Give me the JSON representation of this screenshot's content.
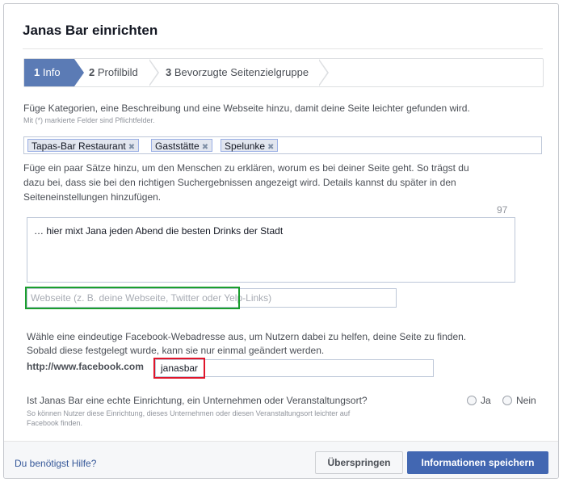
{
  "dialog": {
    "title": "Janas Bar einrichten"
  },
  "steps": [
    {
      "num": "1",
      "label": "Info"
    },
    {
      "num": "2",
      "label": "Profilbild"
    },
    {
      "num": "3",
      "label": "Bevorzugte Seitenzielgruppe"
    }
  ],
  "categories": {
    "intro": "Füge Kategorien, eine Beschreibung und eine Webseite hinzu, damit deine Seite leichter gefunden wird.",
    "required_note": "Mit (*) markierte Felder sind Pflichtfelder.",
    "tokens": [
      "Tapas-Bar Restaurant",
      "Gaststätte",
      "Spelunke"
    ],
    "remove_glyph": "✖"
  },
  "description": {
    "help_line1": "Füge ein paar Sätze hinzu, um den Menschen zu erklären, worum es bei deiner Seite geht. So trägst du",
    "help_line2": "dazu bei, dass sie bei den richtigen Suchergebnissen angezeigt wird. Details kannst du später in den",
    "help_line3": "Seiteneinstellungen hinzufügen.",
    "remaining": "97",
    "value": "… hier mixt Jana jeden Abend die besten Drinks der Stadt"
  },
  "website": {
    "placeholder": "Webseite (z. B. deine Webseite, Twitter oder Yelp-Links)"
  },
  "address": {
    "help_line1": "Wähle eine eindeutige Facebook-Webadresse aus, um Nutzern dabei zu helfen, deine Seite zu finden.",
    "help_line2": "Sobald diese festgelegt wurde, kann sie nur einmal geändert werden.",
    "prefix": "http://www.facebook.com",
    "value": "janasbar"
  },
  "establishment": {
    "question": "Ist Janas Bar eine echte Einrichtung, ein Unternehmen oder Veranstaltungsort?",
    "note_line1": "So können Nutzer diese Einrichtung, dieses Unternehmen oder diesen Veranstaltungsort leichter auf",
    "note_line2": "Facebook finden.",
    "yes": "Ja",
    "no": "Nein"
  },
  "footer": {
    "help": "Du benötigst Hilfe?",
    "skip": "Überspringen",
    "save": "Informationen speichern"
  },
  "colors": {
    "accent": "#4267b2",
    "step_active": "#5b7bb5",
    "highlight_green": "#1a9e2e",
    "highlight_red": "#e0162b"
  }
}
